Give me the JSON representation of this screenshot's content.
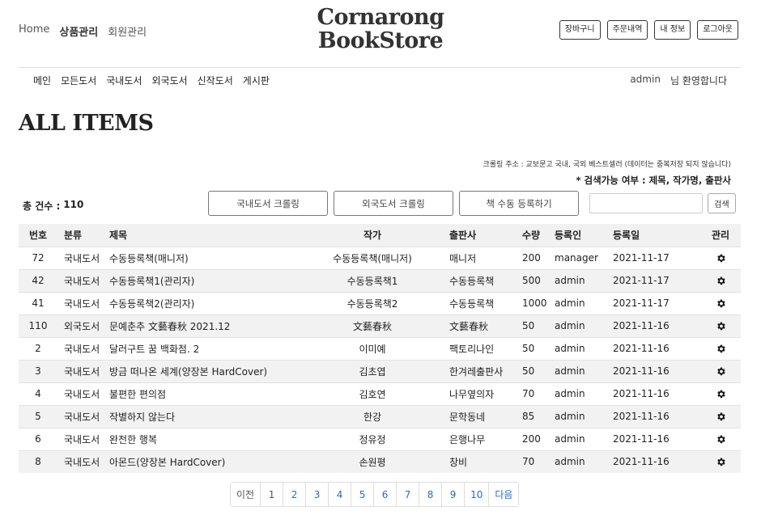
{
  "header": {
    "nav": [
      "Home",
      "상품관리",
      "회원관리"
    ],
    "logo_line1": "Cornarong",
    "logo_line2": "BookStore",
    "account": [
      "장바구니",
      "주문내역",
      "내 정보",
      "로그아웃"
    ]
  },
  "mainnav": [
    "메인",
    "모든도서",
    "국내도서",
    "외국도서",
    "신작도서",
    "게시판"
  ],
  "welcome": {
    "user": "admin",
    "message": "님 환영합니다"
  },
  "page_title": "ALL ITEMS",
  "notes": {
    "crawl": "크롤링 주소 : 교보문고 국내, 국외 베스트셀러 (데이터는 중복저장 되지 않습니다)",
    "search_fields": "* 검색가능 여부 : 제목, 작가명, 출판사"
  },
  "total": {
    "label": "총 건수 :",
    "value": "110"
  },
  "actions": [
    "국내도서 크롤링",
    "외국도서 크롤링",
    "책 수동 등록하기"
  ],
  "search": {
    "placeholder": "",
    "button": "검색"
  },
  "table": {
    "headers": [
      "번호",
      "분류",
      "제목",
      "작가",
      "출판사",
      "수량",
      "등록인",
      "등록일",
      "관리"
    ],
    "rows": [
      [
        "72",
        "국내도서",
        "수동등록책(매니저)",
        "수동등록책(매니저)",
        "매니저",
        "200",
        "manager",
        "2021-11-17"
      ],
      [
        "42",
        "국내도서",
        "수동등록책1(관리자)",
        "수동등록책1",
        "수동등록책",
        "500",
        "admin",
        "2021-11-17"
      ],
      [
        "41",
        "국내도서",
        "수동등록책2(관리자)",
        "수동등록책2",
        "수동등록책",
        "1000",
        "admin",
        "2021-11-17"
      ],
      [
        "110",
        "외국도서",
        "문예춘추 文藝春秋 2021.12",
        "文藝春秋",
        "文藝春秋",
        "50",
        "admin",
        "2021-11-16"
      ],
      [
        "2",
        "국내도서",
        "달러구트 꿈 백화점. 2",
        "이미예",
        "팩토리나인",
        "50",
        "admin",
        "2021-11-16"
      ],
      [
        "3",
        "국내도서",
        "방금 떠나온 세계(양장본 HardCover)",
        "김초엽",
        "한겨레출판사",
        "50",
        "admin",
        "2021-11-16"
      ],
      [
        "4",
        "국내도서",
        "불편한 편의점",
        "김호연",
        "나무옆의자",
        "70",
        "admin",
        "2021-11-16"
      ],
      [
        "5",
        "국내도서",
        "작별하지 않는다",
        "한강",
        "문학동네",
        "85",
        "admin",
        "2021-11-16"
      ],
      [
        "6",
        "국내도서",
        "완전한 행복",
        "정유정",
        "은행나무",
        "200",
        "admin",
        "2021-11-16"
      ],
      [
        "8",
        "국내도서",
        "아몬드(양장본 HardCover)",
        "손원평",
        "창비",
        "70",
        "admin",
        "2021-11-16"
      ]
    ]
  },
  "pagination": [
    "이전",
    "1",
    "2",
    "3",
    "4",
    "5",
    "6",
    "7",
    "8",
    "9",
    "10",
    "다음"
  ],
  "icons": {
    "manage": "gear-icon"
  }
}
